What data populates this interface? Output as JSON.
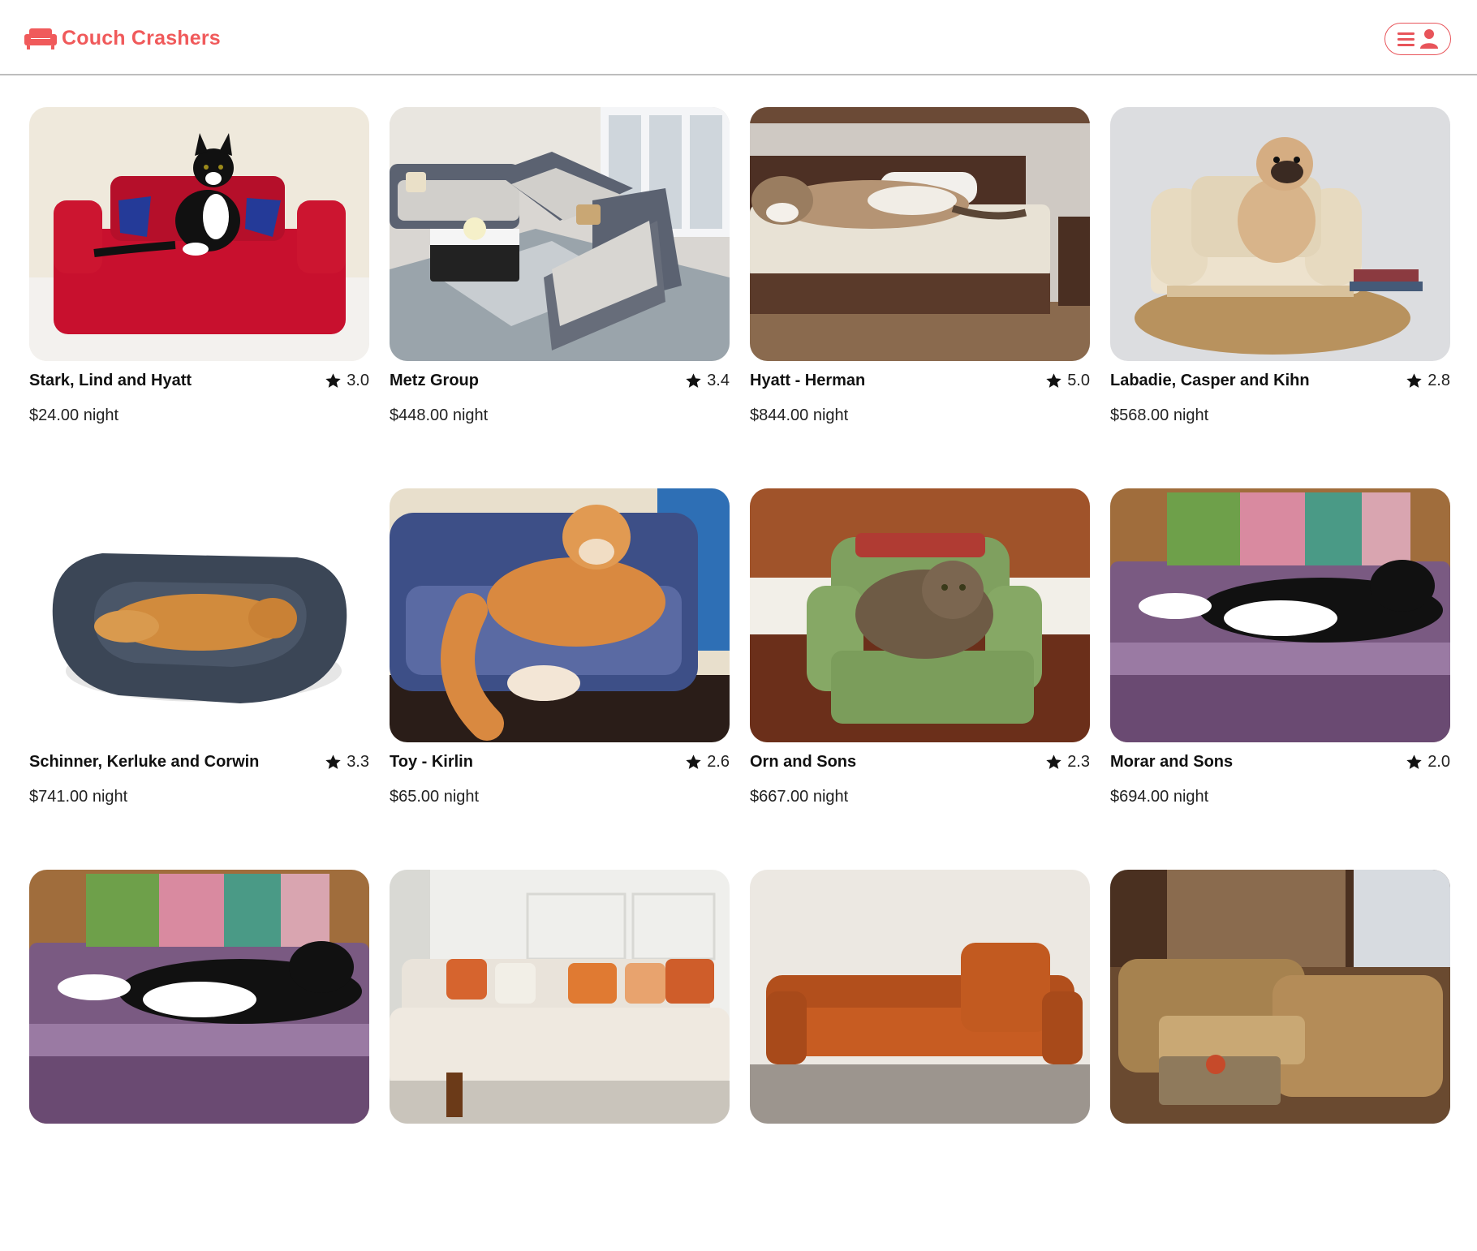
{
  "header": {
    "brand": "Couch Crashers",
    "brand_icon": "couch-icon",
    "menu_icons": [
      "hamburger-menu-icon",
      "user-icon"
    ],
    "accent_color": "#f05a5b"
  },
  "listings": [
    {
      "title": "Stark, Lind and Hyatt",
      "rating": "3.0",
      "price": "$24.00 night",
      "image": "red crocheted couch with black and white cat"
    },
    {
      "title": "Metz Group",
      "rating": "3.4",
      "price": "$448.00 night",
      "image": "grey sectional sofa in living room"
    },
    {
      "title": "Hyatt - Herman",
      "rating": "5.0",
      "price": "$844.00 night",
      "image": "tabby cat lying on bed"
    },
    {
      "title": "Labadie, Casper and Kihn",
      "rating": "2.8",
      "price": "$568.00 night",
      "image": "pug sitting on small cream sofa"
    },
    {
      "title": "Schinner, Kerluke and Corwin",
      "rating": "3.3",
      "price": "$741.00 night",
      "image": "golden retriever on navy dog bed"
    },
    {
      "title": "Toy - Kirlin",
      "rating": "2.6",
      "price": "$65.00 night",
      "image": "orange long-haired cat on crocheted couch"
    },
    {
      "title": "Orn and Sons",
      "rating": "2.3",
      "price": "$667.00 night",
      "image": "tabby cat in green crocheted armchair"
    },
    {
      "title": "Morar and Sons",
      "rating": "2.0",
      "price": "$694.00 night",
      "image": "tuxedo cat on purple crocheted sofa"
    },
    {
      "title": "",
      "rating": "",
      "price": "",
      "image": "tuxedo cat on purple crocheted sofa"
    },
    {
      "title": "",
      "rating": "",
      "price": "",
      "image": "white sofa with orange cushions"
    },
    {
      "title": "",
      "rating": "",
      "price": "",
      "image": "orange leather sofa"
    },
    {
      "title": "",
      "rating": "",
      "price": "",
      "image": "ornate brown sectional sofa"
    }
  ]
}
